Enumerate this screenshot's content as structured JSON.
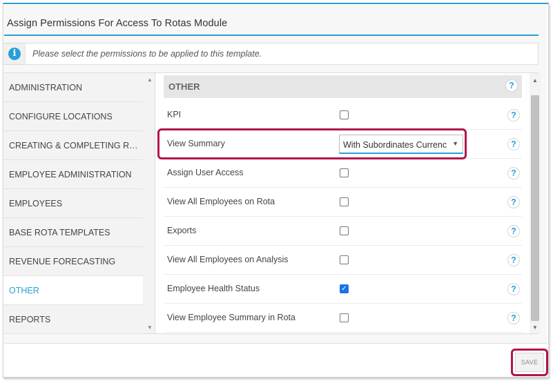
{
  "header": {
    "title": "Assign Permissions For Access To Rotas Module"
  },
  "info": {
    "text": "Please select the permissions to be applied to this template."
  },
  "sidebar": {
    "items": [
      {
        "label": "ADMINISTRATION"
      },
      {
        "label": "CONFIGURE LOCATIONS"
      },
      {
        "label": "CREATING & COMPLETING ROT..."
      },
      {
        "label": "EMPLOYEE ADMINISTRATION"
      },
      {
        "label": "EMPLOYEES"
      },
      {
        "label": "BASE ROTA TEMPLATES"
      },
      {
        "label": "REVENUE FORECASTING"
      },
      {
        "label": "OTHER"
      },
      {
        "label": "REPORTS"
      }
    ],
    "active": "OTHER"
  },
  "section": {
    "title": "OTHER",
    "help": "?",
    "rows": [
      {
        "name": "KPI",
        "checked": false
      },
      {
        "name": "View Summary",
        "select_value": "With Subordinates Currenc"
      },
      {
        "name": "Assign User Access",
        "checked": false
      },
      {
        "name": "View All Employees on Rota",
        "checked": false
      },
      {
        "name": "Exports",
        "checked": false
      },
      {
        "name": "View All Employees on Analysis",
        "checked": false
      },
      {
        "name": "Employee Health Status",
        "checked": true
      },
      {
        "name": "View Employee Summary in Rota",
        "checked": false
      }
    ]
  },
  "footer": {
    "save_label": "SAVE"
  },
  "colors": {
    "accent": "#2a9fd6",
    "highlight": "#b3124c",
    "checkbox_checked": "#1a73e8"
  },
  "icons": {
    "info": "info-icon",
    "help": "help-icon",
    "dropdown": "caret-down-icon"
  }
}
